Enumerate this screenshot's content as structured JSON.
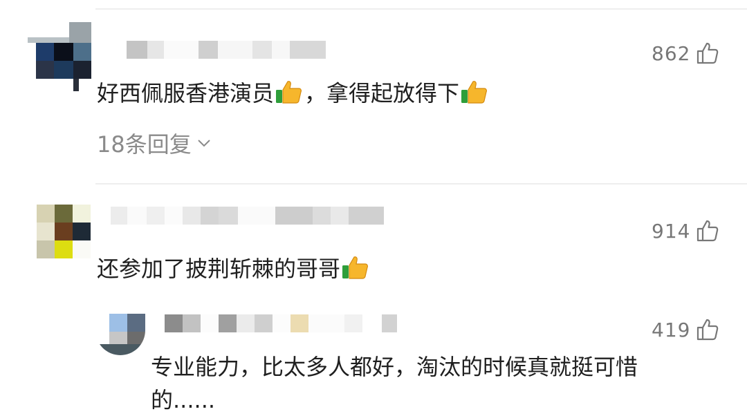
{
  "comments": [
    {
      "likes": "862",
      "text_before": "好西佩服香港演员",
      "text_middle": "，拿得起放得下",
      "replies_label": "18条回复"
    },
    {
      "likes": "914",
      "text_before": "还参加了披荆斩棘的哥哥",
      "reply": {
        "likes": "419",
        "line1": "专业能力，比太多人都好，淘汰的时候真就挺可惜",
        "line2": "的......"
      }
    }
  ],
  "icons": {
    "like": "thumbs-up-outline-icon",
    "emoji": "thumbs-up-emoji-icon",
    "expand": "chevron-down-icon"
  },
  "colors": {
    "text": "#1f1f1f",
    "muted": "#8a8a8a",
    "count": "#777777",
    "divider": "#eeeeee"
  }
}
